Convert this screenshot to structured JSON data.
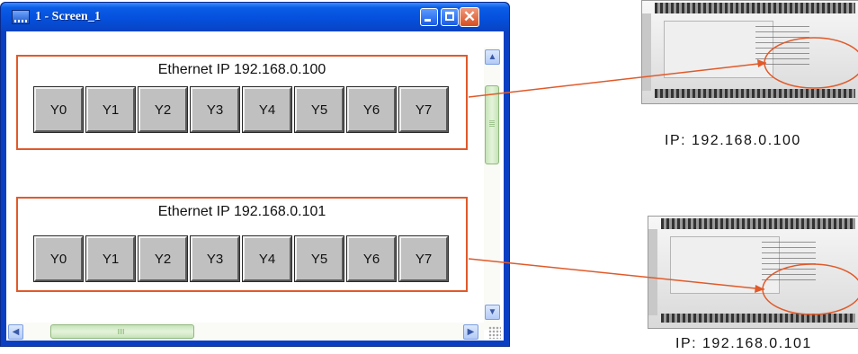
{
  "window": {
    "title": "1 - Screen_1",
    "close_glyph": "✕",
    "colors": {
      "accent": "#e05a2a",
      "titlebar": "#0550dc",
      "button_face": "#c0c0c0"
    }
  },
  "panels": [
    {
      "title": "Ethernet IP 192.168.0.100",
      "buttons": [
        "Y0",
        "Y1",
        "Y2",
        "Y3",
        "Y4",
        "Y5",
        "Y6",
        "Y7"
      ]
    },
    {
      "title": "Ethernet IP 192.168.0.101",
      "buttons": [
        "Y0",
        "Y1",
        "Y2",
        "Y3",
        "Y4",
        "Y5",
        "Y6",
        "Y7"
      ]
    }
  ],
  "scrollbars": {
    "up_glyph": "▲",
    "down_glyph": "▼",
    "left_glyph": "◀",
    "right_glyph": "▶"
  },
  "devices": [
    {
      "ip_label": "IP: 192.168.0.100",
      "icon": "plc-device-icon"
    },
    {
      "ip_label": "IP: 192.168.0.101",
      "icon": "plc-device-icon"
    }
  ]
}
